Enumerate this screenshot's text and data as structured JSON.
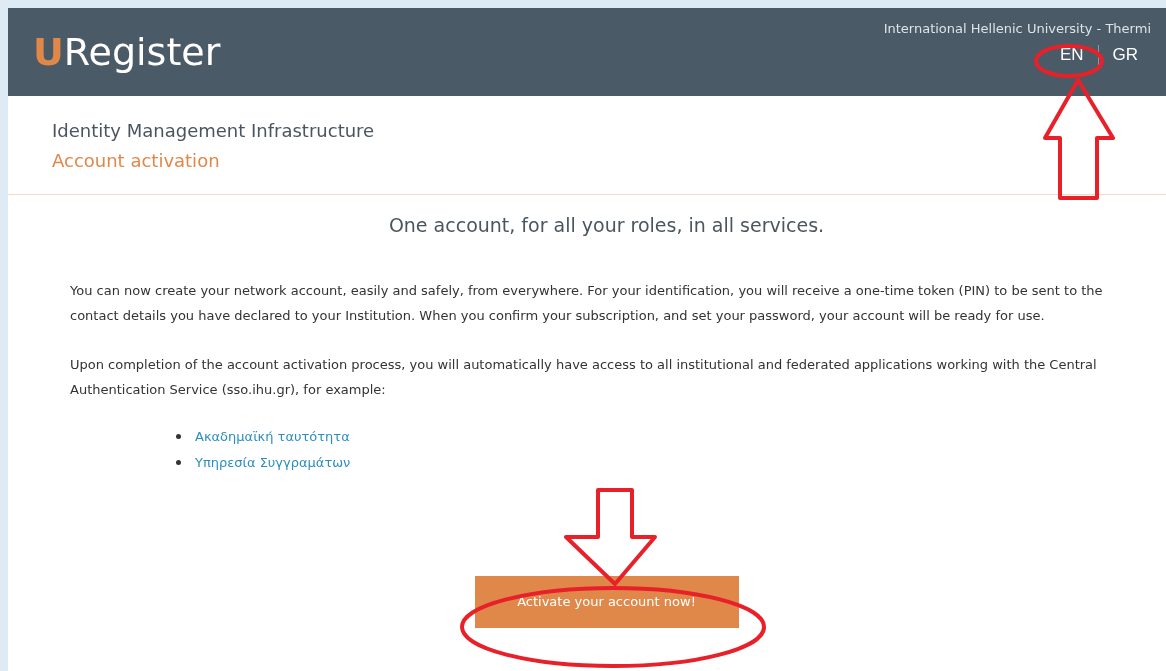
{
  "header": {
    "logo_initial": "U",
    "logo_rest": "Register",
    "institution": "International Hellenic University - Thermi",
    "languages": [
      "EN",
      "GR"
    ]
  },
  "page": {
    "title": "Identity Management Infrastructure",
    "subtitle": "Account activation"
  },
  "content": {
    "heading": "One account, for all your roles, in all services.",
    "paragraphs": [
      "You can now create your network account, easily and safely, from everywhere. For your identification, you will receive a one-time token (PIN) to be sent to the contact details you have declared to your Institution. When you confirm your subscription, and set your password, your account will be ready for use.",
      "Upon completion of the account activation process, you will automatically have access to all institutional and federated applications working with the Central Authentication Service (sso.ihu.gr), for example:"
    ],
    "links": [
      "Ακαδημαϊκή ταυτότητα",
      "Υπηρεσία Συγγραμάτων"
    ],
    "button": "Activate your account now!"
  }
}
